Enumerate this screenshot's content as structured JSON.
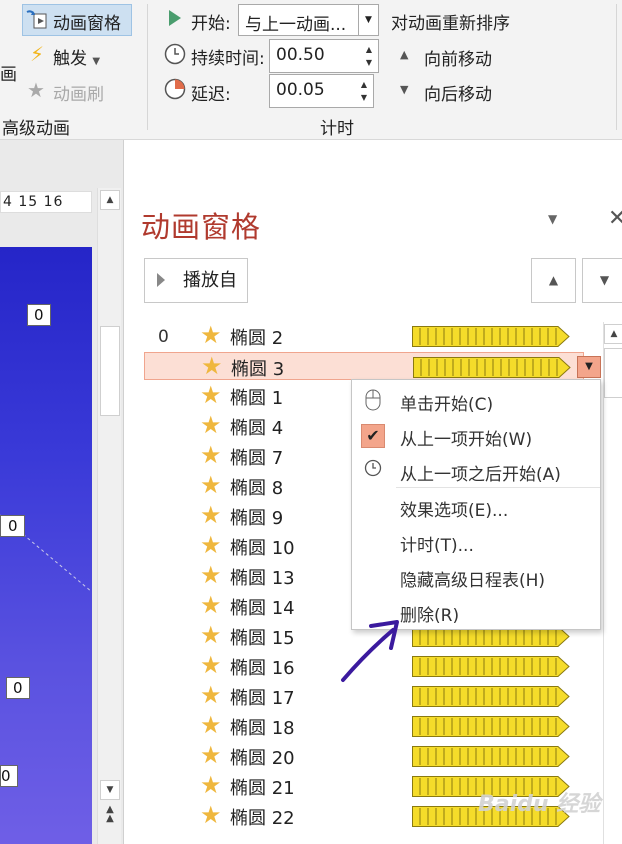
{
  "ribbon": {
    "animation_pane_button": "动画窗格",
    "trigger_button": "触发",
    "animation_painter_button": "动画刷",
    "left_cut_label": "画",
    "advanced_group_label": "高级动画",
    "start_label": "开始:",
    "start_value": "与上一动画...",
    "duration_label": "持续时间:",
    "duration_value": "00.50",
    "delay_label": "延迟:",
    "delay_value": "00.05",
    "timing_group_label": "计时",
    "reorder_title": "对动画重新排序",
    "move_earlier": "向前移动",
    "move_later": "向后移动"
  },
  "slide": {
    "ruler_text": "4 15 16",
    "box_values": [
      "0",
      "0",
      "0",
      "0"
    ]
  },
  "pane": {
    "title": "动画窗格",
    "play_from_button": "播放自",
    "group_number": "0",
    "items": [
      {
        "label": "椭圆 2"
      },
      {
        "label": "椭圆 3"
      },
      {
        "label": "椭圆 1"
      },
      {
        "label": "椭圆 4"
      },
      {
        "label": "椭圆 7"
      },
      {
        "label": "椭圆 8"
      },
      {
        "label": "椭圆 9"
      },
      {
        "label": "椭圆 10"
      },
      {
        "label": "椭圆 13"
      },
      {
        "label": "椭圆 14"
      },
      {
        "label": "椭圆 15"
      },
      {
        "label": "椭圆 16"
      },
      {
        "label": "椭圆 17"
      },
      {
        "label": "椭圆 18"
      },
      {
        "label": "椭圆 20"
      },
      {
        "label": "椭圆 21"
      },
      {
        "label": "椭圆 22"
      }
    ]
  },
  "context_menu": {
    "items": [
      {
        "label": "单击开始(C)",
        "icon": "mouse-icon",
        "checked": false
      },
      {
        "label": "从上一项开始(W)",
        "icon": "checkmark-icon",
        "checked": true
      },
      {
        "label": "从上一项之后开始(A)",
        "icon": "clock-icon",
        "checked": false
      },
      {
        "label": "效果选项(E)...",
        "icon": "",
        "checked": false
      },
      {
        "label": "计时(T)...",
        "icon": "",
        "checked": false
      },
      {
        "label": "隐藏高级日程表(H)",
        "icon": "",
        "checked": false
      },
      {
        "label": "删除(R)",
        "icon": "",
        "checked": false
      }
    ]
  },
  "watermark": "Baidu 经验",
  "colors": {
    "selected_row": "#fcdfd5",
    "timeline_bar": "#f5dc2a",
    "star": "#efb73e",
    "annotation_arrow": "#3b1a9e",
    "pane_title": "#b03a2e"
  }
}
